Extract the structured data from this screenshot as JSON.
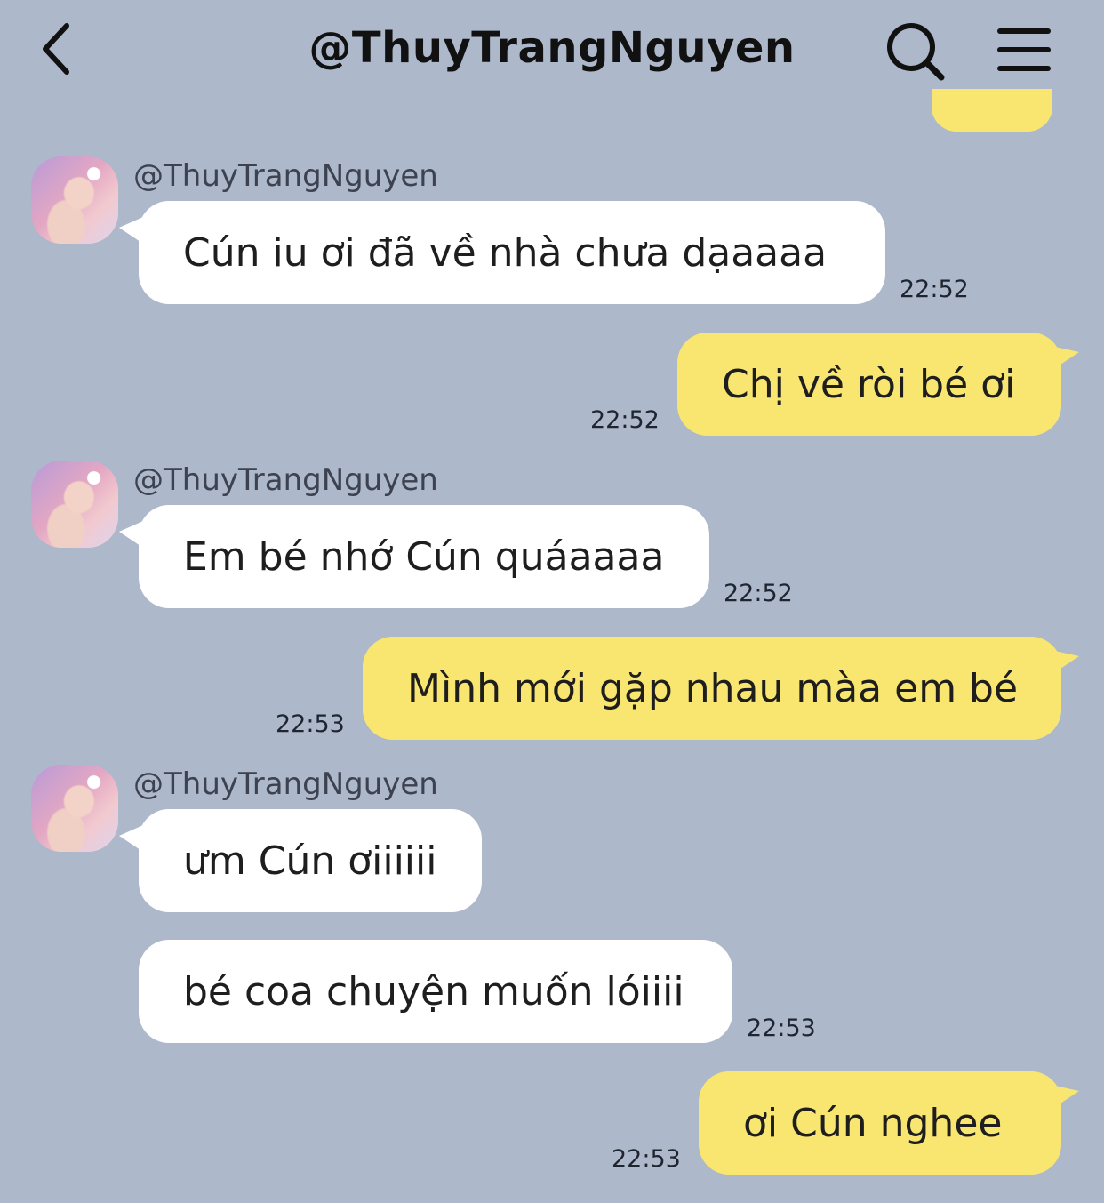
{
  "header": {
    "back_icon": "chevron-left-icon",
    "title": "@ThuyTrangNguyen",
    "search_icon": "search-icon",
    "menu_icon": "hamburger-menu-icon"
  },
  "colors": {
    "background": "#adb8ca",
    "incoming_bubble": "#ffffff",
    "outgoing_bubble": "#f8e671"
  },
  "messages": [
    {
      "sender": "@ThuyTrangNguyen",
      "text": "Cún iu ơi đã về nhà chưa dạaaaa",
      "time": "22:52",
      "direction": "in"
    },
    {
      "text": "Chị về ròi bé ơi",
      "time": "22:52",
      "direction": "out"
    },
    {
      "sender": "@ThuyTrangNguyen",
      "text": "Em bé nhớ Cún quáaaaa",
      "time": "22:52",
      "direction": "in"
    },
    {
      "text": "Mình mới gặp nhau màa em bé",
      "time": "22:53",
      "direction": "out"
    },
    {
      "sender": "@ThuyTrangNguyen",
      "text": "ưm Cún ơiiiiii",
      "direction": "in"
    },
    {
      "text": "bé coa chuyện muốn lóiiii",
      "time": "22:53",
      "direction": "in"
    },
    {
      "text": "ơi Cún nghee",
      "time": "22:53",
      "direction": "out"
    }
  ]
}
